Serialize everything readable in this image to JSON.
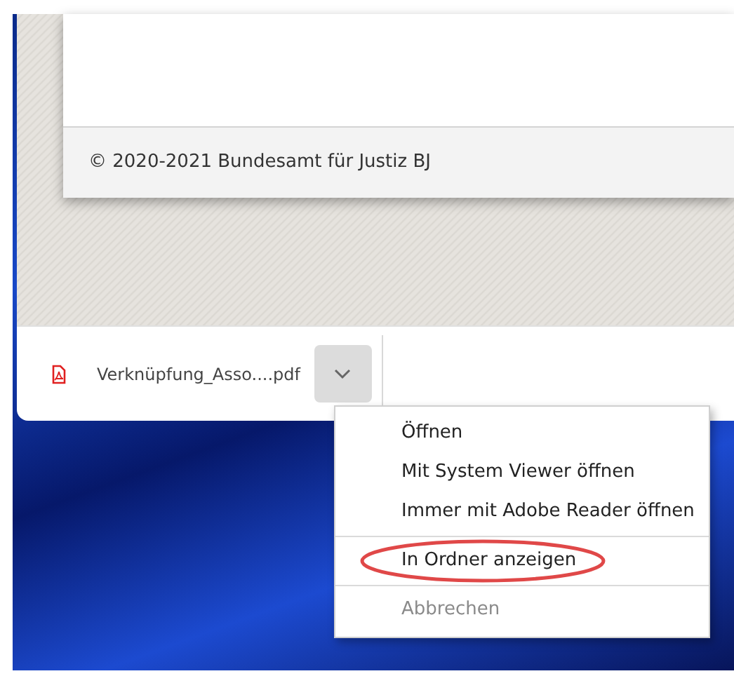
{
  "page_footer": {
    "copyright": "© 2020-2021 Bundesamt für Justiz BJ"
  },
  "download_bar": {
    "file_name": "Verknüpfung_Asso....pdf",
    "menu_open": true
  },
  "menu": {
    "groups": [
      [
        {
          "label": "Öffnen",
          "disabled": false,
          "circled": false
        },
        {
          "label": "Mit System Viewer öffnen",
          "disabled": false,
          "circled": false
        },
        {
          "label": "Immer mit Adobe Reader öffnen",
          "disabled": false,
          "circled": false
        }
      ],
      [
        {
          "label": "In Ordner anzeigen",
          "disabled": false,
          "circled": true
        }
      ],
      [
        {
          "label": "Abbrechen",
          "disabled": true,
          "circled": false
        }
      ]
    ]
  }
}
